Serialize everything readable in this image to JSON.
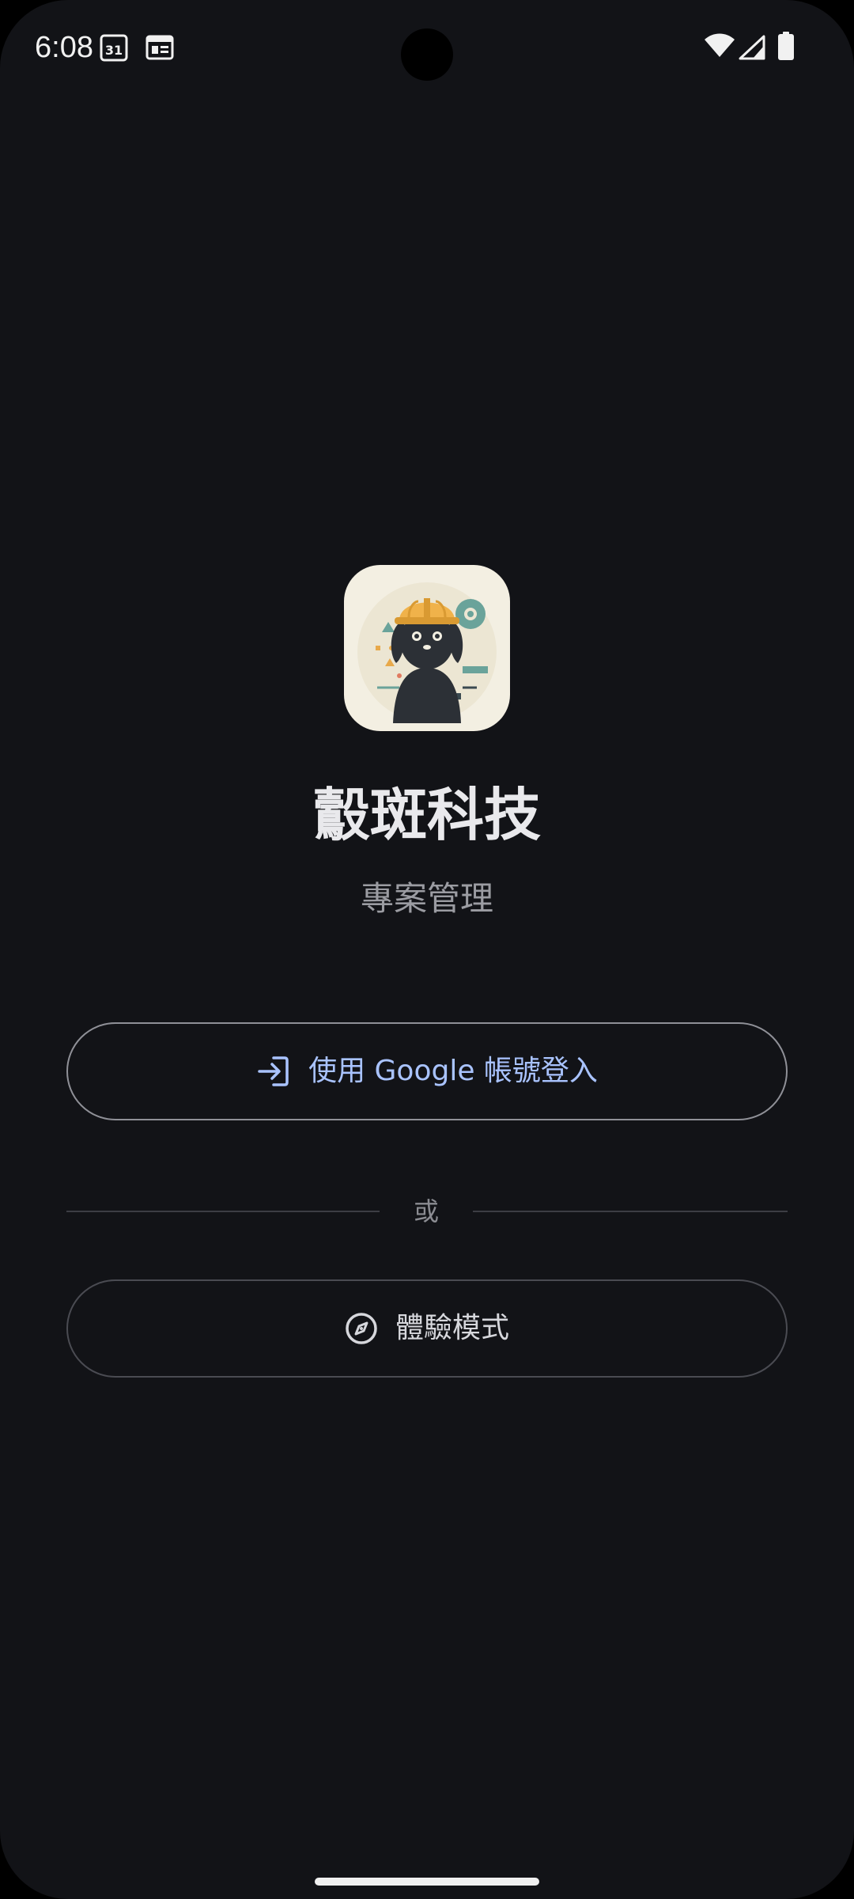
{
  "status_bar": {
    "time": "6:08",
    "calendar_badge": "31",
    "icons": [
      "calendar-icon",
      "news-icon",
      "wifi-icon",
      "signal-icon",
      "battery-icon"
    ]
  },
  "app": {
    "logo_icon": "dog-with-hardhat-logo",
    "title": "鷇斑科技",
    "subtitle": "專案管理"
  },
  "buttons": {
    "google_login": {
      "icon": "login-arrow-icon",
      "label": "使用 Google 帳號登入"
    },
    "demo_mode": {
      "icon": "compass-icon",
      "label": "體驗模式"
    }
  },
  "divider": {
    "text": "或"
  },
  "colors": {
    "background": "#121317",
    "accent": "#a9c3ff",
    "title": "#e9e9ec",
    "subtitle": "#9b9ca2",
    "outline": "#8f9097"
  }
}
